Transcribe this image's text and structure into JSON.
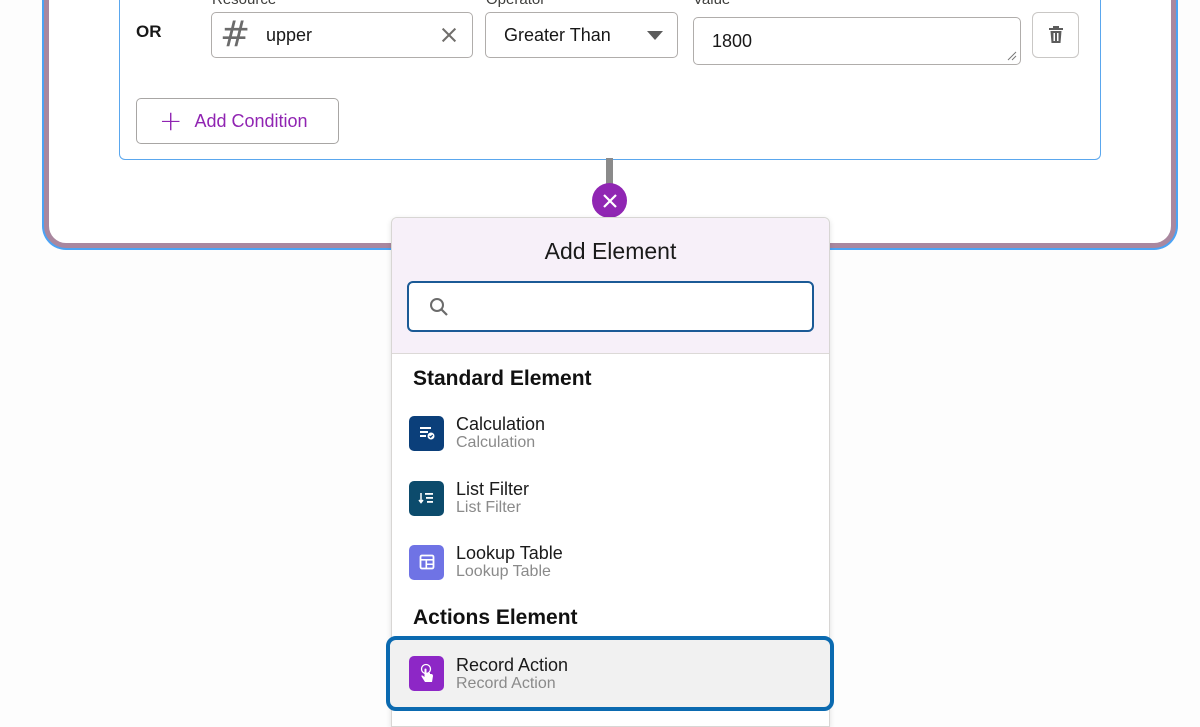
{
  "condition_row": {
    "resource_label_cut": "Resource",
    "operator_label_cut": "Operator",
    "value_label_cut": "Value",
    "logic_label": "OR",
    "resource_icon": "#",
    "resource_value": "upper",
    "operator_value": "Greater Than",
    "value_value": "1800"
  },
  "add_condition_label": "Add Condition",
  "popover": {
    "title": "Add Element",
    "search_placeholder": "",
    "sections": [
      {
        "title": "Standard Element",
        "items": [
          {
            "label": "Calculation",
            "sublabel": "Calculation",
            "icon": "calculation-icon",
            "color": "#0b3f7a"
          },
          {
            "label": "List Filter",
            "sublabel": "List Filter",
            "icon": "list-filter-icon",
            "color": "#0c4b6c"
          },
          {
            "label": "Lookup Table",
            "sublabel": "Lookup Table",
            "icon": "lookup-table-icon",
            "color": "#6f73e5"
          }
        ]
      },
      {
        "title": "Actions Element",
        "items": [
          {
            "label": "Record Action",
            "sublabel": "Record Action",
            "icon": "touch-icon",
            "color": "#8d27c6"
          }
        ]
      }
    ]
  },
  "colors": {
    "accent_purple": "#9026b3",
    "focus_blue": "#0b6ab0",
    "frame_border": "#a9879f"
  }
}
